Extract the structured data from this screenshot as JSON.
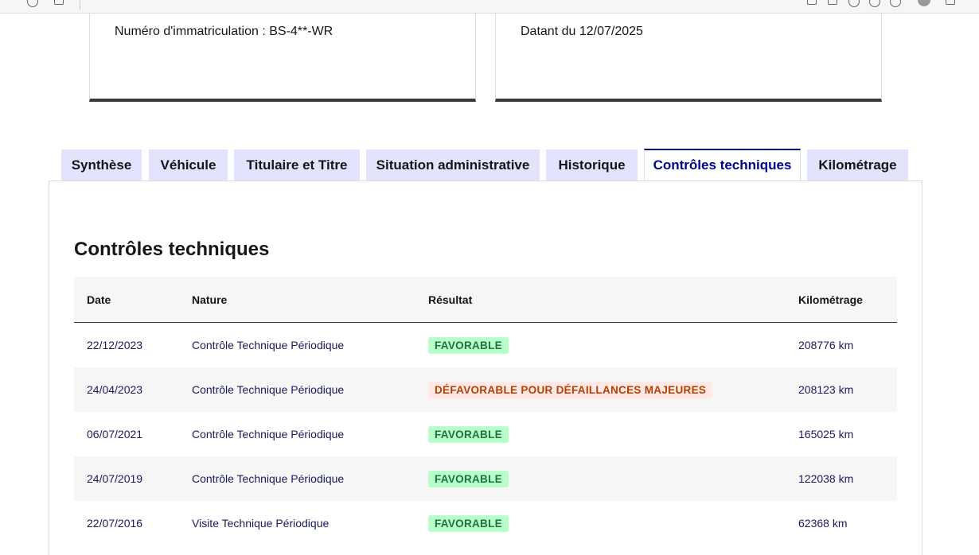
{
  "colors": {
    "tab_background": "#e3e3fd",
    "tab_active_text": "#000091",
    "badge_ok_bg": "#b8fec9",
    "badge_ok_text": "#18753c",
    "badge_ko_bg": "#ffe9e6",
    "badge_ko_text": "#b34000"
  },
  "cards": {
    "left_text": "Numéro d'immatriculation : BS-4**-WR",
    "right_text": "Datant du 12/07/2025"
  },
  "tabs": [
    {
      "label": "Synthèse",
      "active": false
    },
    {
      "label": "Véhicule",
      "active": false
    },
    {
      "label": "Titulaire et Titre",
      "active": false
    },
    {
      "label": "Situation administrative",
      "active": false
    },
    {
      "label": "Historique",
      "active": false
    },
    {
      "label": "Contrôles techniques",
      "active": true
    },
    {
      "label": "Kilométrage",
      "active": false
    }
  ],
  "section": {
    "title": "Contrôles techniques"
  },
  "table": {
    "headers": {
      "date": "Date",
      "nature": "Nature",
      "result": "Résultat",
      "km": "Kilométrage"
    },
    "rows": [
      {
        "date": "22/12/2023",
        "nature": "Contrôle Technique Périodique",
        "result": "FAVORABLE",
        "status": "ok",
        "km": "208776 km"
      },
      {
        "date": "24/04/2023",
        "nature": "Contrôle Technique Périodique",
        "result": "DÉFAVORABLE POUR DÉFAILLANCES MAJEURES",
        "status": "ko",
        "km": "208123 km"
      },
      {
        "date": "06/07/2021",
        "nature": "Contrôle Technique Périodique",
        "result": "FAVORABLE",
        "status": "ok",
        "km": "165025 km"
      },
      {
        "date": "24/07/2019",
        "nature": "Contrôle Technique Périodique",
        "result": "FAVORABLE",
        "status": "ok",
        "km": "122038 km"
      },
      {
        "date": "22/07/2016",
        "nature": "Visite Technique Périodique",
        "result": "FAVORABLE",
        "status": "ok",
        "km": "62368 km"
      }
    ]
  }
}
